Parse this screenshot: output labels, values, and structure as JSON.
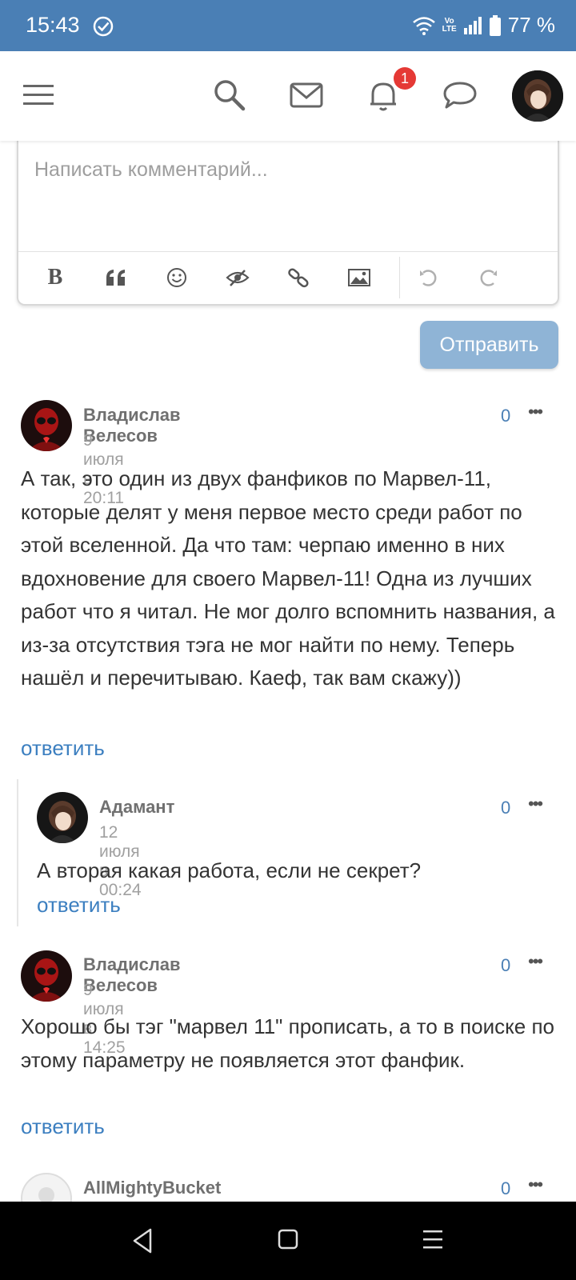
{
  "status": {
    "time": "15:43",
    "battery": "77 %",
    "volte_top": "Vo",
    "volte_bottom": "LTE"
  },
  "header": {
    "icons": [
      "menu-icon",
      "search-icon",
      "mail-icon",
      "bell-icon",
      "chat-icon"
    ],
    "notification_count": "1"
  },
  "editor": {
    "placeholder": "Написать комментарий...",
    "tools": [
      "bold",
      "quote",
      "emoji",
      "spoiler",
      "link",
      "image",
      "undo",
      "redo"
    ],
    "bold_label": "B",
    "send_label": "Отправить"
  },
  "comments": [
    {
      "author": "Владислав Велесов",
      "date": "9 июля в 20:11",
      "score": "0",
      "text": "А так, это один из двух фанфиков по Марвел-11, которые делят у меня первое место среди работ по этой вселенной. Да что там: черпаю именно в них вдохновение для своего Марвел-11! Одна из лучших работ что я читал. Не мог долго вспомнить названия, а из-за отсутствия тэга не мог найти по нему. Теперь нашёл и перечитываю. Каеф, так вам скажу))",
      "reply_label": "ответить"
    },
    {
      "author": "Адамант",
      "date": "12 июля в 00:24",
      "score": "0",
      "text": "А вторая какая работа, если не секрет?",
      "reply_label": "ответить"
    },
    {
      "author": "Владислав Велесов",
      "date": "9 июля в 14:25",
      "score": "0",
      "text": "Хорошо бы тэг \"марвел 11\" прописать, а то в поиске по этому параметру не появляется этот фанфик.",
      "reply_label": "ответить"
    },
    {
      "author": "AllMightyBucket",
      "score": "0"
    }
  ],
  "more_glyph": "•••",
  "colors": {
    "accent": "#4a7fb5",
    "link": "#3c7fc0",
    "send_button": "#8fb4d6",
    "badge": "#e53935"
  }
}
